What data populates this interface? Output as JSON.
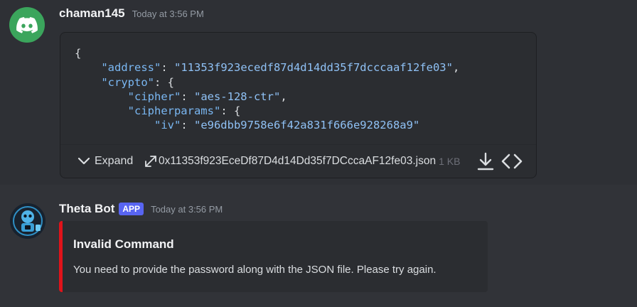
{
  "message1": {
    "username": "chaman145",
    "timestamp": "Today at 3:56 PM",
    "code_lines": [
      {
        "prefix": "{",
        "key": "",
        "mid": "",
        "value": "",
        "suffix": ""
      },
      {
        "prefix": "    ",
        "key": "\"address\"",
        "mid": ": ",
        "value": "\"11353f923ecedf87d4d14dd35f7dcccaaf12fe03\"",
        "suffix": ","
      },
      {
        "prefix": "    ",
        "key": "\"crypto\"",
        "mid": ": {",
        "value": "",
        "suffix": ""
      },
      {
        "prefix": "        ",
        "key": "\"cipher\"",
        "mid": ": ",
        "value": "\"aes-128-ctr\"",
        "suffix": ","
      },
      {
        "prefix": "        ",
        "key": "\"cipherparams\"",
        "mid": ": {",
        "value": "",
        "suffix": ""
      },
      {
        "prefix": "            ",
        "key": "\"iv\"",
        "mid": ": ",
        "value": "\"e96dbb9758e6f42a831f666e928268a9\"",
        "suffix": ""
      }
    ],
    "expand_label": "Expand",
    "file_name": "0x11353f923EceDf87D4d14Dd35f7DCccaAF12fe03.json",
    "file_size": "1 KB"
  },
  "message2": {
    "bot_name": "Theta Bot",
    "badge": "APP",
    "timestamp": "Today at 3:56 PM",
    "embed": {
      "title": "Invalid Command",
      "description": "You need to provide the password along with the JSON file. Please try again.",
      "accent_color": "#e0131a"
    }
  },
  "colors": {
    "background": "#313338",
    "message_hover": "#2e3035",
    "card": "#2b2d31",
    "brand": "#5865f2",
    "avatar_green": "#3ba55c"
  }
}
